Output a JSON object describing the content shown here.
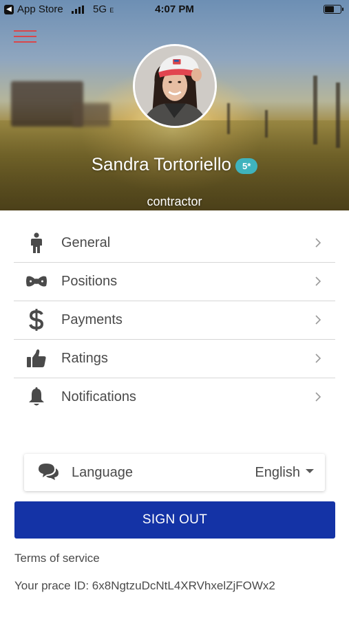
{
  "status_bar": {
    "back_app": "App Store",
    "network": "5G",
    "network_suffix": "E",
    "time": "4:07 PM"
  },
  "profile": {
    "name": "Sandra Tortoriello",
    "rating": "5*",
    "role": "contractor"
  },
  "menu": {
    "items": [
      {
        "label": "General",
        "icon": "person-icon"
      },
      {
        "label": "Positions",
        "icon": "bow-tie-icon"
      },
      {
        "label": "Payments",
        "icon": "dollar-icon"
      },
      {
        "label": "Ratings",
        "icon": "thumbs-up-icon"
      },
      {
        "label": "Notifications",
        "icon": "bell-icon"
      }
    ]
  },
  "language": {
    "label": "Language",
    "selected": "English",
    "icon": "chat-bubble-icon"
  },
  "actions": {
    "sign_out": "SIGN OUT",
    "terms": "Terms of service"
  },
  "footer": {
    "prace_id_label": "Your prace ID:",
    "prace_id": "6x8NgtzuDcNtL4XRVhxelZjFOWx2"
  },
  "colors": {
    "accent_red": "#d9464a",
    "badge_teal": "#3fb3bd",
    "primary_blue": "#1433a6",
    "icon_gray": "#4a4a4a"
  }
}
